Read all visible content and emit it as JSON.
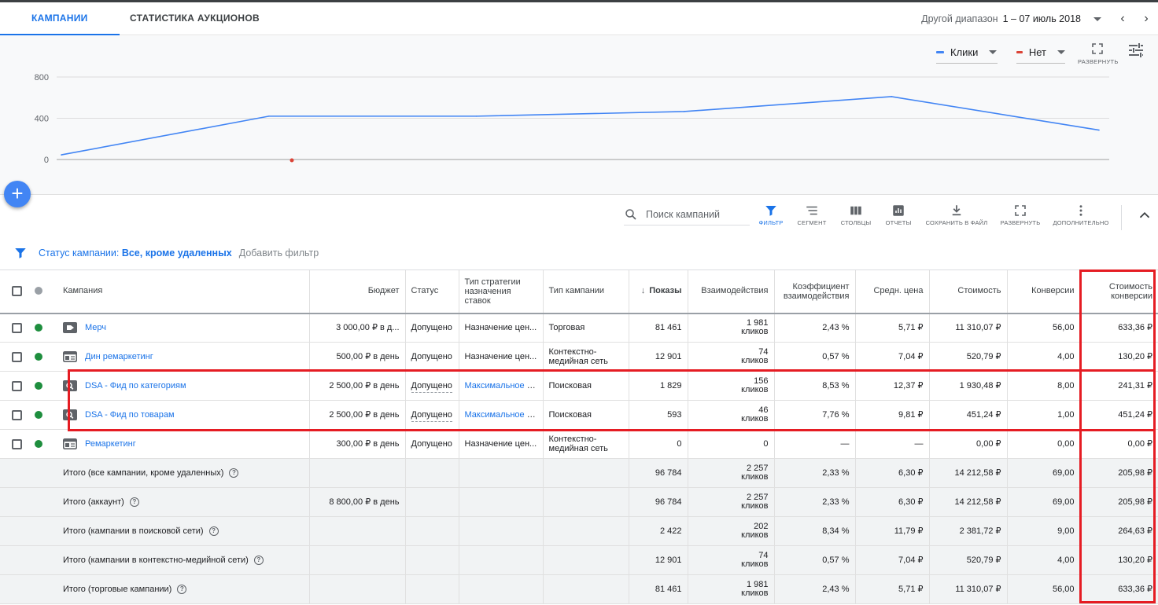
{
  "tabs": [
    {
      "label": "КАМПАНИИ",
      "active": true
    },
    {
      "label": "СТАТИСТИКА АУКЦИОНОВ",
      "active": false
    }
  ],
  "date_range": {
    "label": "Другой диапазон",
    "value": "1 – 07 июль 2018"
  },
  "chart_controls": {
    "metric1": {
      "label": "Клики",
      "color": "#4285f4"
    },
    "metric2": {
      "label": "Нет",
      "color": "#db4437"
    },
    "expand_label": "РАЗВЕРНУТЬ"
  },
  "chart_data": {
    "type": "line",
    "y_ticks": [
      "800",
      "400",
      "0"
    ],
    "ylim": [
      0,
      800
    ],
    "series": [
      {
        "name": "Клики",
        "color": "#4285f4",
        "values": [
          45,
          420,
          420,
          465,
          610,
          285
        ]
      }
    ],
    "x_points": 6,
    "secondary_point": {
      "color": "#db4437",
      "value": 0
    },
    "grid": true
  },
  "toolbar": {
    "search_placeholder": "Поиск кампаний",
    "buttons": [
      {
        "label": "ФИЛЬТР",
        "icon": "filter-icon",
        "active": true
      },
      {
        "label": "СЕГМЕНТ",
        "icon": "segment-icon",
        "active": false
      },
      {
        "label": "СТОЛБЦЫ",
        "icon": "columns-icon",
        "active": false
      },
      {
        "label": "ОТЧЕТЫ",
        "icon": "reports-icon",
        "active": false
      },
      {
        "label": "СОХРАНИТЬ В ФАЙЛ",
        "icon": "download-icon",
        "active": false
      },
      {
        "label": "РАЗВЕРНУТЬ",
        "icon": "fullscreen-icon",
        "active": false
      },
      {
        "label": "ДОПОЛНИТЕЛЬНО",
        "icon": "more-icon",
        "active": false
      }
    ]
  },
  "filter": {
    "prefix": "Статус кампании: ",
    "value": "Все, кроме удаленных",
    "add_label": "Добавить фильтр"
  },
  "columns": {
    "campaign": "Кампания",
    "budget": "Бюджет",
    "status": "Статус",
    "bid_strategy": "Тип стратегии назначения ставок",
    "campaign_type": "Тип кампании",
    "impressions": "Показы",
    "interactions": "Взаимодействия",
    "interaction_rate": "Коэффициент взаимодействия",
    "avg_cost": "Средн. цена",
    "cost": "Стоимость",
    "conversions": "Конверсии",
    "cost_per_conv": "Стоимость конверсии"
  },
  "rows": [
    {
      "icon": "shopping-campaign-icon",
      "name": "Мерч",
      "budget": "3 000,00 ₽ в д...",
      "status": "Допущено",
      "strategy": "Назначение цен...",
      "strategy_link": false,
      "type": "Торговая",
      "impressions": "81 461",
      "interactions": "1 981",
      "interactions_unit": "кликов",
      "rate": "2,43 %",
      "avg": "5,71 ₽",
      "cost": "11 310,07 ₽",
      "conv": "56,00",
      "cpc": "633,36 ₽"
    },
    {
      "icon": "display-campaign-icon",
      "name": "Дин ремаркетинг",
      "budget": "500,00 ₽ в день",
      "status": "Допущено",
      "strategy": "Назначение цен...",
      "strategy_link": false,
      "type": "Контекстно-медийная сеть",
      "impressions": "12 901",
      "interactions": "74",
      "interactions_unit": "кликов",
      "rate": "0,57 %",
      "avg": "7,04 ₽",
      "cost": "520,79 ₽",
      "conv": "4,00",
      "cpc": "130,20 ₽"
    },
    {
      "icon": "search-campaign-icon",
      "name": "DSA - Фид по категориям",
      "budget": "2 500,00 ₽ в день",
      "status": "Допущено",
      "strategy": "Максимальное к...",
      "strategy_link": true,
      "type": "Поисковая",
      "impressions": "1 829",
      "interactions": "156",
      "interactions_unit": "кликов",
      "rate": "8,53 %",
      "avg": "12,37 ₽",
      "cost": "1 930,48 ₽",
      "conv": "8,00",
      "cpc": "241,31 ₽"
    },
    {
      "icon": "search-campaign-icon",
      "name": "DSA - Фид по товарам",
      "budget": "2 500,00 ₽ в день",
      "status": "Допущено",
      "strategy": "Максимальное к...",
      "strategy_link": true,
      "type": "Поисковая",
      "impressions": "593",
      "interactions": "46",
      "interactions_unit": "кликов",
      "rate": "7,76 %",
      "avg": "9,81 ₽",
      "cost": "451,24 ₽",
      "conv": "1,00",
      "cpc": "451,24 ₽"
    },
    {
      "icon": "display-campaign-icon",
      "name": "Ремаркетинг",
      "budget": "300,00 ₽ в день",
      "status": "Допущено",
      "strategy": "Назначение цен...",
      "strategy_link": false,
      "type": "Контекстно-медийная сеть",
      "impressions": "0",
      "interactions": "0",
      "interactions_unit": "",
      "rate": "—",
      "avg": "—",
      "cost": "0,00 ₽",
      "conv": "0,00",
      "cpc": "0,00 ₽"
    }
  ],
  "totals": [
    {
      "label": "Итого (все кампании, кроме удаленных)",
      "budget": "",
      "impressions": "96 784",
      "interactions": "2 257",
      "interactions_unit": "кликов",
      "rate": "2,33 %",
      "avg": "6,30 ₽",
      "cost": "14 212,58 ₽",
      "conv": "69,00",
      "cpc": "205,98 ₽"
    },
    {
      "label": "Итого (аккаунт)",
      "budget": "8 800,00 ₽ в день",
      "impressions": "96 784",
      "interactions": "2 257",
      "interactions_unit": "кликов",
      "rate": "2,33 %",
      "avg": "6,30 ₽",
      "cost": "14 212,58 ₽",
      "conv": "69,00",
      "cpc": "205,98 ₽"
    },
    {
      "label": "Итого (кампании в поисковой сети)",
      "budget": "",
      "impressions": "2 422",
      "interactions": "202",
      "interactions_unit": "кликов",
      "rate": "8,34 %",
      "avg": "11,79 ₽",
      "cost": "2 381,72 ₽",
      "conv": "9,00",
      "cpc": "264,63 ₽"
    },
    {
      "label": "Итого (кампании в контекстно-медийной сети)",
      "budget": "",
      "impressions": "12 901",
      "interactions": "74",
      "interactions_unit": "кликов",
      "rate": "0,57 %",
      "avg": "7,04 ₽",
      "cost": "520,79 ₽",
      "conv": "4,00",
      "cpc": "130,20 ₽"
    },
    {
      "label": "Итого (торговые кампании)",
      "budget": "",
      "impressions": "81 461",
      "interactions": "1 981",
      "interactions_unit": "кликов",
      "rate": "2,43 %",
      "avg": "5,71 ₽",
      "cost": "11 310,07 ₽",
      "conv": "56,00",
      "cpc": "633,36 ₽"
    }
  ],
  "colors": {
    "accent": "#1a73e8",
    "status_green": "#1e8e3e",
    "highlight": "#e51c23",
    "header_dot": "#9aa0a6"
  }
}
